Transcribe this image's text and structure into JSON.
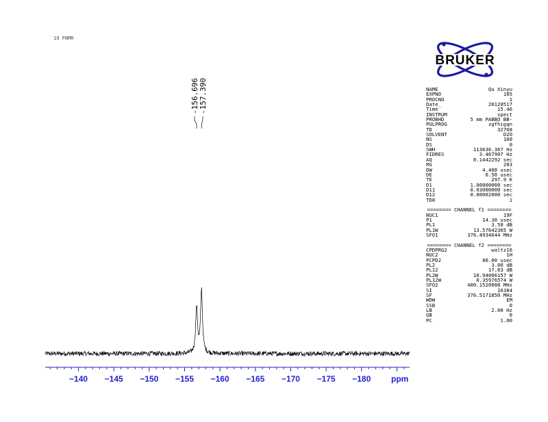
{
  "header": {
    "label": "19 FNMR"
  },
  "logo": {
    "text": "BRUKER",
    "color": "#1a1aa0"
  },
  "chart_data": {
    "type": "line",
    "title": "",
    "xlabel": "ppm",
    "ylabel": "",
    "xlim": [
      -135.3,
      -186.8
    ],
    "x_reversed": true,
    "ylim": [
      0,
      1
    ],
    "grid": false,
    "x_ticks": [
      -140,
      -145,
      -150,
      -155,
      -160,
      -165,
      -170,
      -175,
      -180
    ],
    "x_tick_labels": [
      "−140",
      "−145",
      "−150",
      "−155",
      "−160",
      "−165",
      "−170",
      "−175",
      "−180"
    ],
    "axis_color": "#1f1fcf",
    "peaks": [
      {
        "x": -156.696,
        "height": 0.72
      },
      {
        "x": -157.39,
        "height": 0.99
      }
    ],
    "peak_labels": [
      "-156.696",
      "-157.390"
    ],
    "baseline": 0.0
  },
  "params": [
    {
      "name": "NAME",
      "value": "Qu Xinyu"
    },
    {
      "name": "EXPNO",
      "value": "105"
    },
    {
      "name": "PROCNO",
      "value": "1"
    },
    {
      "name": "Date_",
      "value": "20120517"
    },
    {
      "name": "Time",
      "value": "15.46"
    },
    {
      "name": "INSTRUM",
      "value": "spect"
    },
    {
      "name": "PROBHD",
      "value": "5 mm PABBO BB-"
    },
    {
      "name": "PULPROG",
      "value": "zgfhigqn"
    },
    {
      "name": "TD",
      "value": "32768"
    },
    {
      "name": "SOLVENT",
      "value": "D2O"
    },
    {
      "name": "NS",
      "value": "160"
    },
    {
      "name": "DS",
      "value": "0"
    },
    {
      "name": "SWH",
      "value": "113636.367 Hz"
    },
    {
      "name": "FIDRES",
      "value": "3.467907 Hz"
    },
    {
      "name": "AQ",
      "value": "0.1442292 sec"
    },
    {
      "name": "RG",
      "value": "203"
    },
    {
      "name": "DW",
      "value": "4.400 usec"
    },
    {
      "name": "DE",
      "value": "6.50 usec"
    },
    {
      "name": "TE",
      "value": "297.9 K"
    },
    {
      "name": "D1",
      "value": "1.00000000 sec"
    },
    {
      "name": "D11",
      "value": "0.03000000 sec"
    },
    {
      "name": "D12",
      "value": "0.00002000 sec"
    },
    {
      "name": "TD0",
      "value": "1"
    },
    {
      "gap": true
    },
    {
      "section": "======== CHANNEL f1 ========"
    },
    {
      "name": "NUC1",
      "value": "19F"
    },
    {
      "name": "P1",
      "value": "14.30 usec"
    },
    {
      "name": "PL1",
      "value": "3.50 dB"
    },
    {
      "name": "PL1W",
      "value": "13.57642365 W"
    },
    {
      "name": "SFO1",
      "value": "376.4934644 MHz"
    },
    {
      "gap": true
    },
    {
      "section": "======== CHANNEL f2 ========"
    },
    {
      "name": "CPDPRG2",
      "value": "waltz16"
    },
    {
      "name": "NUC2",
      "value": "1H"
    },
    {
      "name": "PCPD2",
      "value": "80.00 usec"
    },
    {
      "name": "PL2",
      "value": "3.00 dB"
    },
    {
      "name": "PL12",
      "value": "17.83 dB"
    },
    {
      "name": "PL2W",
      "value": "10.94006157 W"
    },
    {
      "name": "PL12W",
      "value": "0.35976574 W"
    },
    {
      "name": "SFO2",
      "value": "400.1520008 MHz"
    },
    {
      "name": "SI",
      "value": "16384"
    },
    {
      "name": "SF",
      "value": "376.5171850 MHz"
    },
    {
      "name": "WDW",
      "value": "EM"
    },
    {
      "name": "SSB",
      "value": "0"
    },
    {
      "name": "LB",
      "value": "2.00 Hz"
    },
    {
      "name": "GB",
      "value": "0"
    },
    {
      "name": "PC",
      "value": "1.00"
    }
  ]
}
